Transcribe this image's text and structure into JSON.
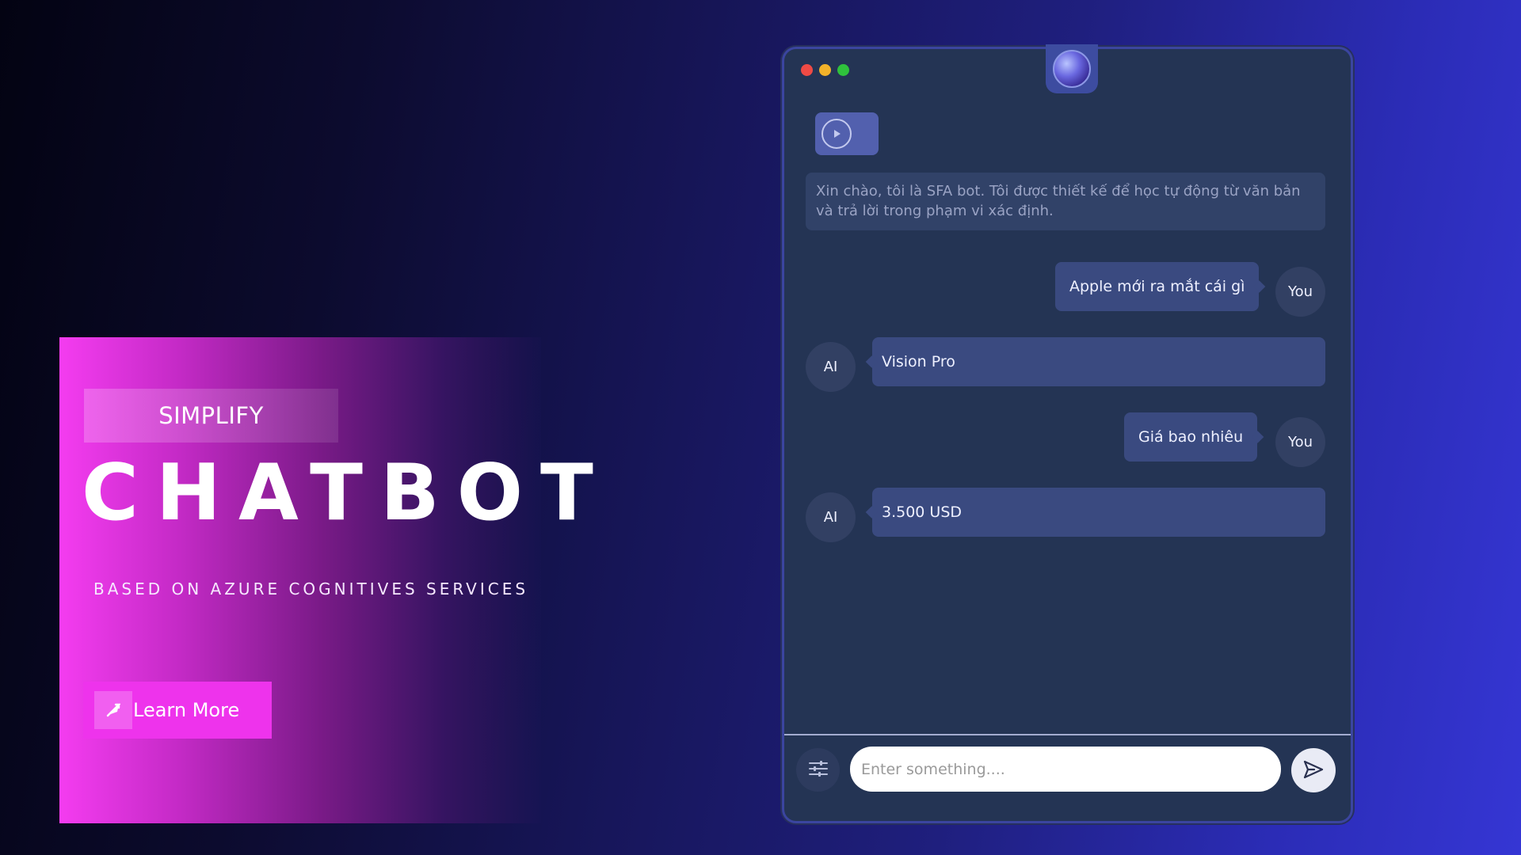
{
  "promo": {
    "tag": "SIMPLIFY",
    "title": "CHATBOT",
    "subtitle": "BASED ON AZURE COGNITIVES SERVICES",
    "cta_label": "Learn More",
    "cta_icon": "arrow-icon",
    "accent_color": "#ee33ec"
  },
  "chat": {
    "window_controls": [
      "close",
      "minimize",
      "maximize"
    ],
    "bot_icon": "globe-icon",
    "audio_icon": "play-icon",
    "greeting": "Xin chào, tôi là SFA bot. Tôi được thiết kế để học tự động từ văn bản và trả lời trong phạm vi xác định.",
    "messages": [
      {
        "role": "user",
        "avatar": "You",
        "text": "Apple mới ra mắt cái gì"
      },
      {
        "role": "ai",
        "avatar": "AI",
        "text": "Vision Pro"
      },
      {
        "role": "user",
        "avatar": "You",
        "text": "Giá bao nhiêu"
      },
      {
        "role": "ai",
        "avatar": "AI",
        "text": "3.500 USD"
      }
    ],
    "input": {
      "placeholder": "Enter something....",
      "value": ""
    },
    "settings_icon": "sliders-icon",
    "send_icon": "send-icon"
  }
}
